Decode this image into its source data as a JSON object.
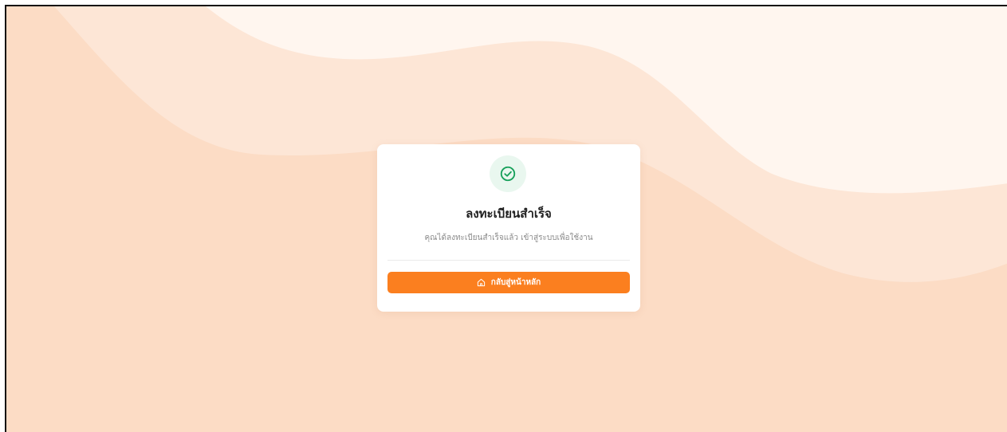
{
  "colors": {
    "background": "#fcdcc5",
    "wave_light": "#fde6d6",
    "wave_lightest": "#fff6ef",
    "card": "#ffffff",
    "accent": "#fb7f1f",
    "success": "#16a05a",
    "success_bg": "#e9f7ef"
  },
  "card": {
    "status_icon": "check-circle-icon",
    "title": "ลงทะเบียนสำเร็จ",
    "message": "คุณได้ลงทะเบียนสำเร็จแล้ว เข้าสู่ระบบเพื่อใช้งาน",
    "button": {
      "icon": "home-icon",
      "label": "กลับสู่หน้าหลัก"
    }
  }
}
